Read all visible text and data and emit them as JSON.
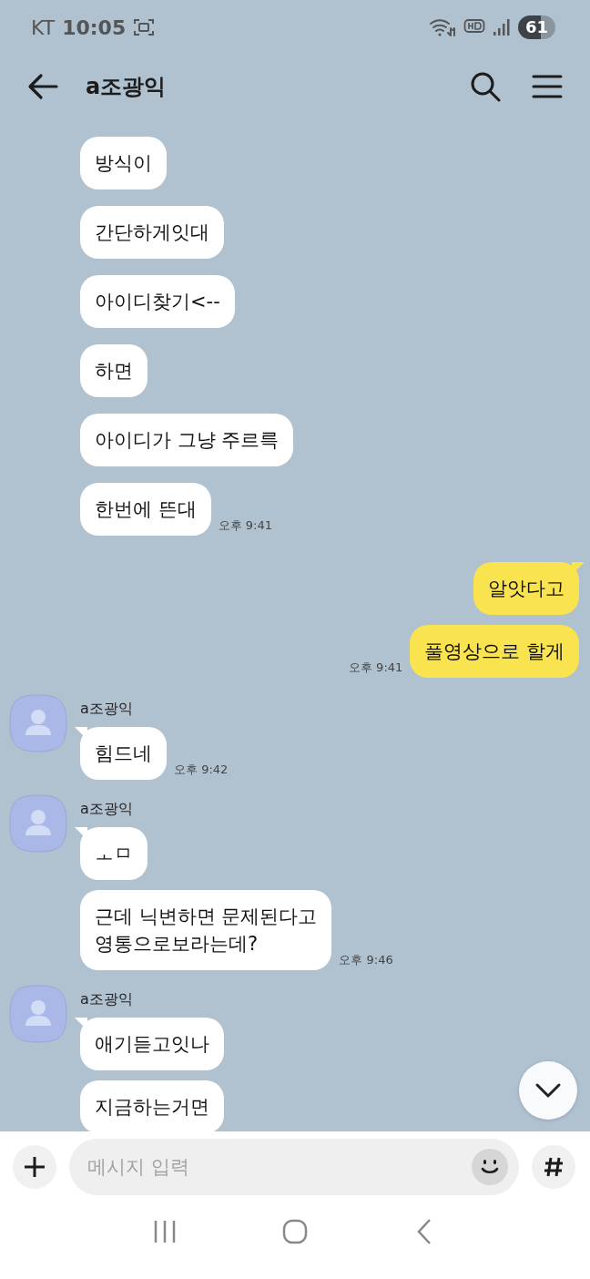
{
  "status_bar": {
    "carrier": "KT",
    "time": "10:05",
    "battery": "61"
  },
  "header": {
    "title": "a조광익"
  },
  "groups": [
    {
      "kind": "received",
      "messages": [
        {
          "text": "방식이"
        },
        {
          "text": "간단하게잇대"
        },
        {
          "text": "아이디찾기<--"
        },
        {
          "text": "하면"
        },
        {
          "text": "아이디가 그냥 주르륵"
        },
        {
          "text": "한번에 뜬대"
        }
      ],
      "time": "오후 9:41"
    },
    {
      "kind": "sent",
      "messages": [
        {
          "text": "알앗다고"
        },
        {
          "text": "풀영상으로 할게"
        }
      ],
      "time": "오후 9:41"
    },
    {
      "kind": "received",
      "sender": "a조광익",
      "messages": [
        {
          "text": "힘드네"
        }
      ],
      "time": "오후 9:42"
    },
    {
      "kind": "received",
      "sender": "a조광익",
      "messages": [
        {
          "text": "ㅗㅁ"
        },
        {
          "text": "근데 닉변하면 문제된다고\n영통으로보라는데?"
        }
      ],
      "time": "오후 9:46"
    },
    {
      "kind": "received",
      "sender": "a조광익",
      "messages": [
        {
          "text": "애기듣고잇나"
        },
        {
          "text": "지금하는거면"
        }
      ]
    }
  ],
  "composer": {
    "placeholder": "메시지 입력"
  }
}
